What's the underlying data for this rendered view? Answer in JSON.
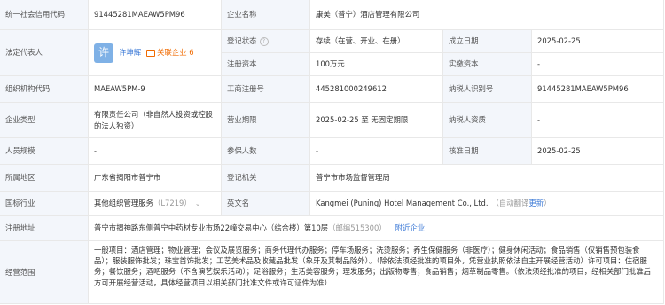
{
  "credit_code": {
    "label": "统一社会信用代码",
    "value": "91445281MAEAW5PM96"
  },
  "company_name": {
    "label": "企业名称",
    "value": "康美（普宁）酒店管理有限公司"
  },
  "legal_rep": {
    "label": "法定代表人",
    "avatar": "许",
    "name": "许坤辉",
    "related_label": "关联企业",
    "related_count": "6"
  },
  "reg_status": {
    "label": "登记状态",
    "value": "存续（在营、开业、在册）",
    "help_icon": "question-circle-icon"
  },
  "est_date": {
    "label": "成立日期",
    "value": "2025-02-25"
  },
  "reg_capital": {
    "label": "注册资本",
    "value": "100万元"
  },
  "paid_capital": {
    "label": "实缴资本",
    "value": "-"
  },
  "org_code": {
    "label": "组织机构代码",
    "value": "MAEAW5PM-9"
  },
  "biz_reg_no": {
    "label": "工商注册号",
    "value": "445281000249612"
  },
  "taxpayer_id": {
    "label": "纳税人识别号",
    "value": "91445281MAEAW5PM96"
  },
  "company_type": {
    "label": "企业类型",
    "value": "有限责任公司（非自然人投资或控股的法人独资）"
  },
  "term": {
    "label": "营业期限",
    "value": "2025-02-25 至 无固定期限"
  },
  "taxpayer_qual": {
    "label": "纳税人资质",
    "value": "-"
  },
  "staff_size": {
    "label": "人员规模",
    "value": "-"
  },
  "insured": {
    "label": "参保人数",
    "value": "-"
  },
  "approval_date": {
    "label": "核准日期",
    "value": "2025-02-25"
  },
  "region": {
    "label": "所属地区",
    "value": "广东省揭阳市普宁市"
  },
  "reg_authority": {
    "label": "登记机关",
    "value": "普宁市市场监督管理局"
  },
  "industry": {
    "label": "国标行业",
    "value": "其他组织管理服务",
    "code": "（L7219）",
    "chevron": "chevron-down-icon"
  },
  "english_name": {
    "label": "英文名",
    "value": "Kangmei (Puning) Hotel Management Co., Ltd.",
    "note": "（自动翻译",
    "update_link": "更新",
    "note_close": "）"
  },
  "address": {
    "label": "注册地址",
    "value": "普宁市揭神路东侧普宁中药材专业市场22幢交易中心（综合楼）第10层",
    "postcode": "（邮编515300）",
    "nearby_link": "附近企业"
  },
  "scope": {
    "label": "经营范围",
    "value": "一般项目：酒店管理；物业管理；会议及展览服务；商务代理代办服务；停车场服务；洗烫服务；养生保健服务（非医疗）；健身休闲活动；食品销售（仅销售预包装食品）；服装服饰批发；珠宝首饰批发；工艺美术品及收藏品批发（象牙及其制品除外）。（除依法须经批准的项目外，凭营业执照依法自主开展经营活动）许可项目：住宿服务；餐饮服务；酒吧服务（不含演艺娱乐活动）；足浴服务；生活美容服务；理发服务；出版物零售；食品销售；烟草制品零售。（依法须经批准的项目，经相关部门批准后方可开展经营活动，具体经营项目以相关部门批准文件或许可证件为准）"
  }
}
